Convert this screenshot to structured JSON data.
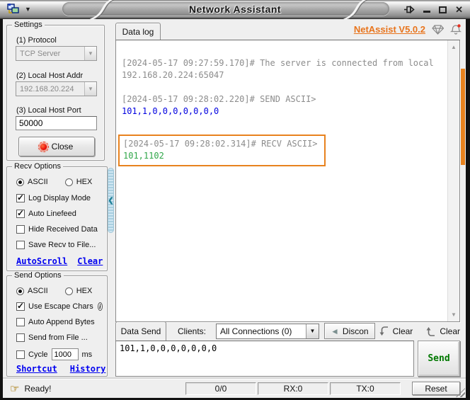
{
  "titlebar": {
    "title": "Network Assistant"
  },
  "settings": {
    "legend": "Settings",
    "protocol_label": "(1) Protocol",
    "protocol_value": "TCP Server",
    "addr_label": "(2) Local Host Addr",
    "addr_value": "192.168.20.224",
    "port_label": "(3) Local Host Port",
    "port_value": "50000",
    "close_label": "Close"
  },
  "recv_options": {
    "legend": "Recv Options",
    "radio_ascii": "ASCII",
    "radio_hex": "HEX",
    "items": [
      {
        "label": "Log Display Mode",
        "checked": true
      },
      {
        "label": "Auto Linefeed",
        "checked": true
      },
      {
        "label": "Hide Received Data",
        "checked": false
      },
      {
        "label": "Save Recv to File...",
        "checked": false
      }
    ],
    "autoscroll_link": "AutoScroll",
    "clear_link": "Clear"
  },
  "send_options": {
    "legend": "Send Options",
    "radio_ascii": "ASCII",
    "radio_hex": "HEX",
    "escape_label": "Use Escape Chars",
    "append_label": "Auto Append Bytes",
    "fromfile_label": "Send from File ...",
    "cycle_label": "Cycle",
    "cycle_value": "1000",
    "cycle_unit": "ms",
    "shortcut_link": "Shortcut",
    "history_link": "History"
  },
  "main": {
    "tab_label": "Data log",
    "version_link": "NetAssist V5.0.2",
    "log": {
      "entry1_line1": "[2024-05-17 09:27:59.170]# The server is connected from local",
      "entry1_line2": "192.168.20.224:65047",
      "entry2_head": "[2024-05-17 09:28:02.220]# SEND ASCII>",
      "entry2_data": "101,1,0,0,0,0,0,0,0",
      "entry3_head": "[2024-05-17 09:28:02.314]# RECV ASCII>",
      "entry3_data": "101,1102"
    }
  },
  "send_area": {
    "tab_label": "Data Send",
    "clients_label": "Clients:",
    "clients_value": "All Connections (0)",
    "discon_label": "Discon",
    "clear_recv_label": "Clear",
    "clear_send_label": "Clear",
    "input_value": "101,1,0,0,0,0,0,0,0",
    "send_label": "Send"
  },
  "statusbar": {
    "ready": "Ready!",
    "counter": "0/0",
    "rx": "RX:0",
    "tx": "TX:0",
    "reset_label": "Reset"
  },
  "colors": {
    "accent_orange": "#E8821E",
    "version_orange": "#E8741C",
    "send_blue": "#0000E0",
    "recv_green": "#2FA648",
    "timestamp_gray": "#8C8C8C",
    "link_blue": "#0000F0",
    "send_button_green": "#007800",
    "close_dot_red": "#E40000"
  }
}
